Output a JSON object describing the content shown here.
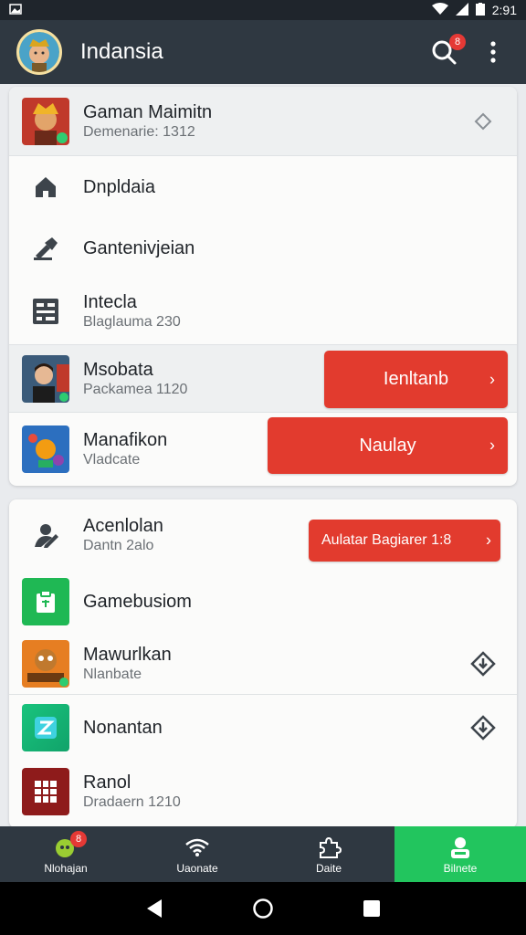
{
  "status_bar": {
    "time": "2:91"
  },
  "app_bar": {
    "title": "Indansia",
    "notification_count": "8"
  },
  "card1": {
    "header": {
      "title": "Gaman Maimitn",
      "subtitle": "Demenarie: 1312"
    },
    "menu": [
      {
        "label": "Dnpldaia",
        "icon": "home-icon"
      },
      {
        "label": "Gantenivjeian",
        "icon": "gavel-icon"
      },
      {
        "label": "Intecla",
        "subtitle": "Blaglauma 230",
        "icon": "grid-icon"
      }
    ],
    "offers": [
      {
        "title": "Msobata",
        "subtitle": "Packamea 1120",
        "button": "Ienltanb"
      },
      {
        "title": "Manafikon",
        "subtitle": "Vladcate",
        "button": "Naulay"
      }
    ]
  },
  "card2": {
    "items": [
      {
        "title": "Acenlolan",
        "subtitle": "Dantn 2alo",
        "button": "Aulatar Bagiarer 1:8",
        "icon": "user-edit-icon"
      },
      {
        "title": "Gamebusiom",
        "icon": "app-icon-green"
      },
      {
        "title": "Mawurlkan",
        "subtitle": "Nlanbate",
        "icon": "game-thumb"
      },
      {
        "title": "Nonantan",
        "icon": "app-icon-z"
      },
      {
        "title": "Ranol",
        "subtitle": "Dradaern 1210",
        "icon": "game-thumb-red"
      }
    ]
  },
  "bottom_nav": {
    "items": [
      {
        "label": "Nlohajan",
        "badge": "8"
      },
      {
        "label": "Uaonate"
      },
      {
        "label": "Daite"
      },
      {
        "label": "Bilnete"
      }
    ]
  },
  "colors": {
    "primary_red": "#e23b2e",
    "active_green": "#22c55e",
    "app_bar": "#2f3841"
  }
}
